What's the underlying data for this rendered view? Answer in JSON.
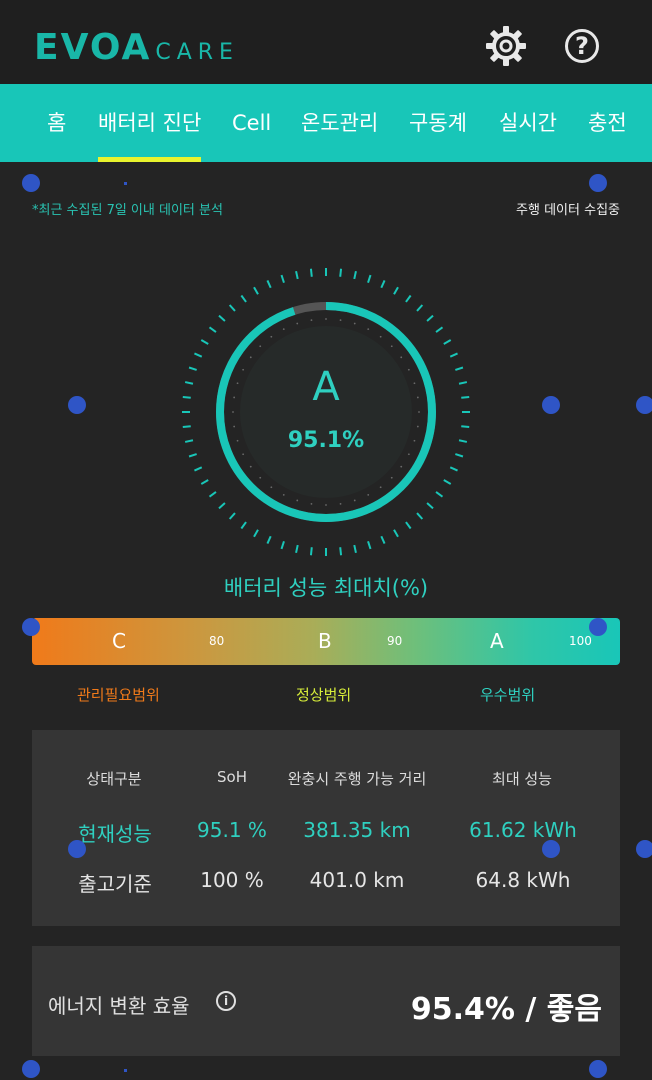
{
  "header": {
    "logo_main": "EVOA",
    "logo_sub": "CARE",
    "settings_icon": "gear-icon",
    "help_icon": "help-icon",
    "help_glyph": "?"
  },
  "tabs": [
    {
      "label": "홈",
      "active": false
    },
    {
      "label": "배터리 진단",
      "active": true
    },
    {
      "label": "Cell",
      "active": false
    },
    {
      "label": "온도관리",
      "active": false
    },
    {
      "label": "구동계",
      "active": false
    },
    {
      "label": "실시간",
      "active": false
    },
    {
      "label": "충전",
      "active": false
    }
  ],
  "notes": {
    "left": "*최근 수집된 7일 이내 데이터 분석",
    "right": "주행 데이터 수집중"
  },
  "gauge": {
    "grade": "A",
    "percent_text": "95.1%",
    "percent_value": 95.1,
    "title": "배터리 성능 최대치(%)"
  },
  "scale": {
    "grade_c": "C",
    "mark_80": "80",
    "grade_b": "B",
    "mark_90": "90",
    "grade_a": "A",
    "mark_100": "100",
    "range_low": "관리필요범위",
    "range_mid": "정상범위",
    "range_high": "우수범위"
  },
  "table": {
    "headers": [
      "상태구분",
      "SoH",
      "완충시 주행 가능 거리",
      "최대 성능"
    ],
    "rows": [
      [
        "현재성능",
        "95.1 %",
        "381.35 km",
        "61.62 kWh"
      ],
      [
        "출고기준",
        "100 %",
        "401.0 km",
        "64.8 kWh"
      ]
    ]
  },
  "efficiency": {
    "label": "에너지 변환 효율",
    "info_glyph": "i",
    "value": "95.4% / 좋음"
  },
  "colors": {
    "accent": "#18c6b8",
    "teal_text": "#2fd0c0",
    "tab_indicator": "#e9f32d",
    "range_low": "#f07a1a",
    "range_mid": "#d6ec3a",
    "range_high": "#2fd0c0",
    "background": "#242424",
    "panel": "#353535"
  }
}
